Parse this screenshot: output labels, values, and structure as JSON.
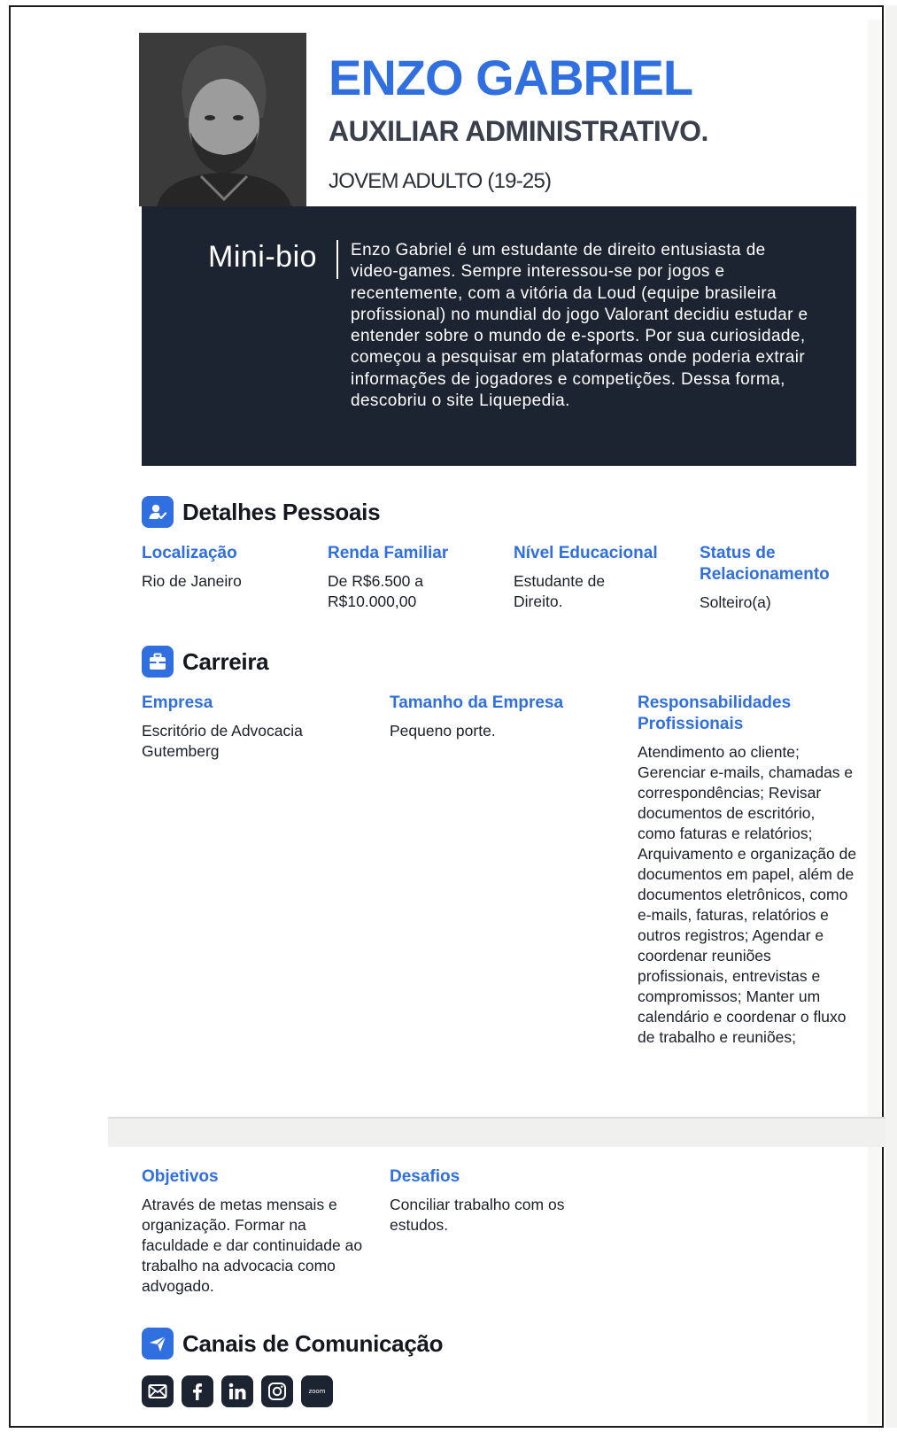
{
  "persona": {
    "name": "ENZO GABRIEL",
    "role": "AUXILIAR ADMINISTRATIVO.",
    "age_group": "JOVEM ADULTO (19-25)"
  },
  "bio": {
    "title": "Mini-bio",
    "text": "Enzo Gabriel é um estudante de direito entusiasta de video-games. Sempre interessou-se por jogos e recentemente, com a vitória da Loud (equipe brasileira profissional) no mundial do jogo Valorant decidiu estudar e entender sobre o mundo de e-sports. Por sua curiosidade, começou a pesquisar em plataformas onde poderia extrair informações de jogadores e competições. Dessa forma, descobriu o site Liquepedia."
  },
  "personal": {
    "title": "Detalhes Pessoais",
    "icon": "user-icon",
    "fields": [
      {
        "label": "Localização",
        "value": "Rio de Janeiro"
      },
      {
        "label": "Renda Familiar",
        "value": "De R$6.500 a R$10.000,00"
      },
      {
        "label": "Nível Educacional",
        "value": "Estudante de Direito."
      },
      {
        "label": "Status de Relacionamento",
        "value": "Solteiro(a)"
      }
    ]
  },
  "career": {
    "title": "Carreira",
    "icon": "briefcase-icon",
    "fields": [
      {
        "label": "Empresa",
        "value": "Escritório de Advocacia Gutemberg"
      },
      {
        "label": "Tamanho da Empresa",
        "value": "Pequeno porte."
      },
      {
        "label": "Responsabilidades Profissionais",
        "value": "Atendimento ao cliente; Gerenciar e-mails, chamadas e correspondências; Revisar documentos de escritório, como faturas e relatórios; Arquivamento e organização de documentos em papel, além de documentos eletrônicos, como e-mails, faturas, relatórios e outros registros; Agendar e coordenar reuniões profissionais, entrevistas e compromissos; Manter um calendário e coordenar o fluxo de trabalho e reuniões;"
      }
    ]
  },
  "goals": {
    "fields": [
      {
        "label": "Objetivos",
        "value": "Através de metas mensais e organização. Formar na faculdade e dar continuidade ao trabalho na advocacia como advogado."
      },
      {
        "label": "Desafios",
        "value": "Conciliar trabalho com os estudos."
      }
    ]
  },
  "channels": {
    "title": "Canais de Comunicação",
    "icon": "send-icon",
    "items": [
      {
        "name": "email-icon"
      },
      {
        "name": "facebook-icon"
      },
      {
        "name": "linkedin-icon"
      },
      {
        "name": "instagram-icon"
      },
      {
        "name": "zoom-icon",
        "text": "zoom"
      }
    ]
  },
  "colors": {
    "accent": "#2f6fe0",
    "dark": "#1c2331"
  }
}
